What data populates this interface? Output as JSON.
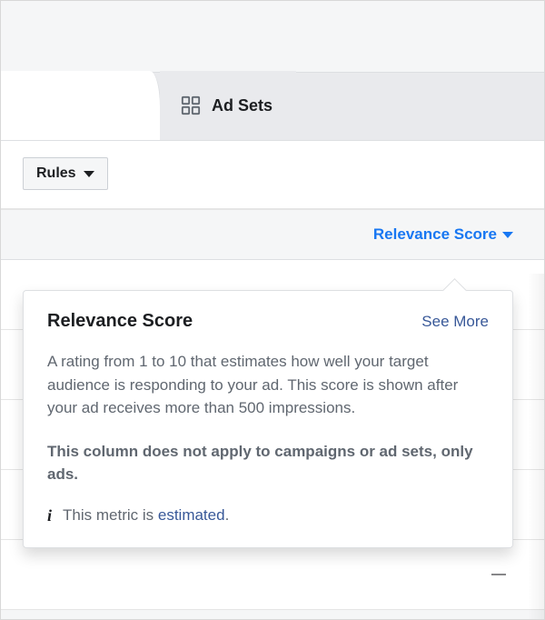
{
  "tabs": {
    "adsets_label": "Ad Sets"
  },
  "toolbar": {
    "rules_label": "Rules"
  },
  "column": {
    "relevance_score_label": "Relevance Score"
  },
  "rows": {
    "empty_value": "—"
  },
  "popover": {
    "title": "Relevance Score",
    "see_more": "See More",
    "description": "A rating from 1 to 10 that estimates how well your target audience is responding to your ad. This score is shown after your ad receives more than 500 impressions.",
    "note": "This column does not apply to campaigns or ad sets, only ads.",
    "footer_prefix": "This metric is ",
    "footer_link": "estimated",
    "footer_suffix": "."
  }
}
